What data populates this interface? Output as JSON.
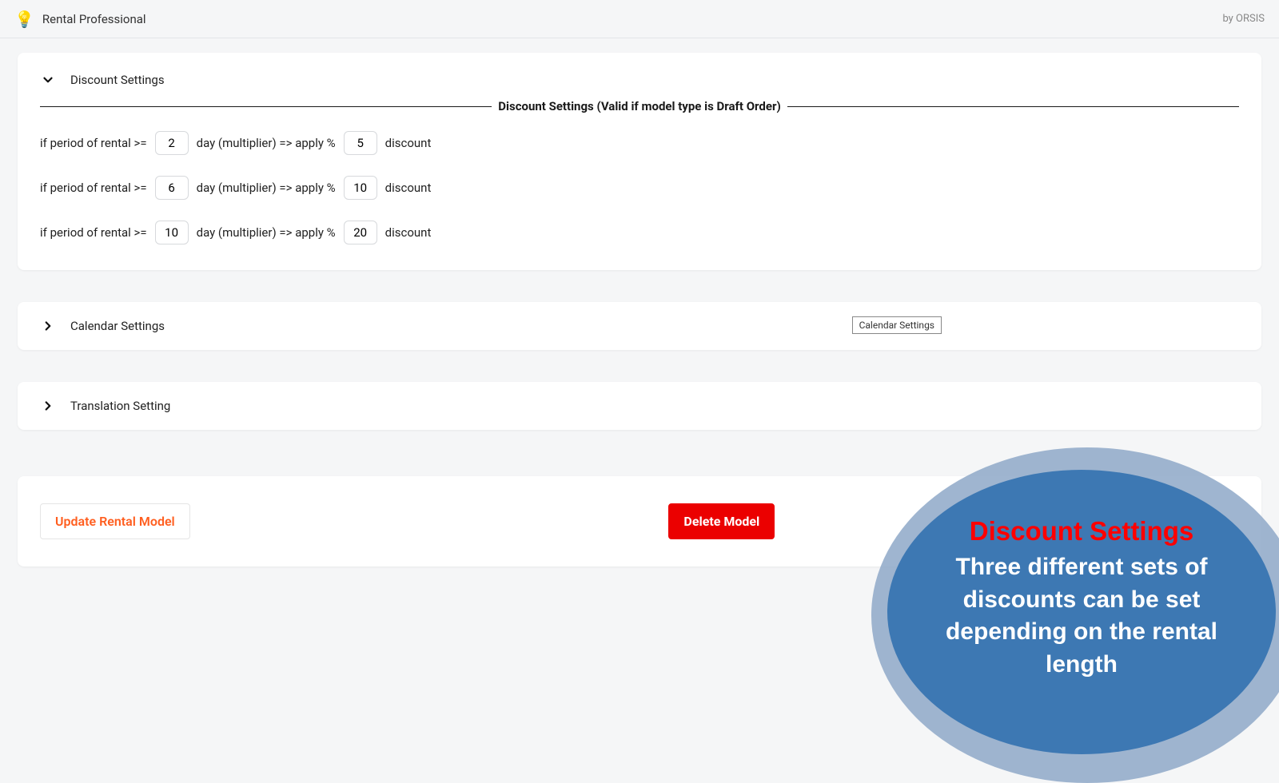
{
  "topbar": {
    "title": "Rental Professional",
    "byline": "by ORSIS"
  },
  "sections": {
    "discount": {
      "title": "Discount Settings",
      "legend": "Discount Settings (Valid if model type is Draft Order)",
      "label_prefix": "if period of rental >=",
      "label_mid": "day (multiplier) => apply %",
      "label_suffix": "discount",
      "rules": [
        {
          "days": "2",
          "pct": "5"
        },
        {
          "days": "6",
          "pct": "10"
        },
        {
          "days": "10",
          "pct": "20"
        }
      ]
    },
    "calendar": {
      "title": "Calendar Settings",
      "tooltip": "Calendar Settings"
    },
    "translation": {
      "title": "Translation Setting"
    }
  },
  "actions": {
    "update_label": "Update Rental Model",
    "delete_label": "Delete Model"
  },
  "annotation": {
    "title": "Discount Settings",
    "body": "Three different sets of discounts can be set depending on the rental length"
  }
}
